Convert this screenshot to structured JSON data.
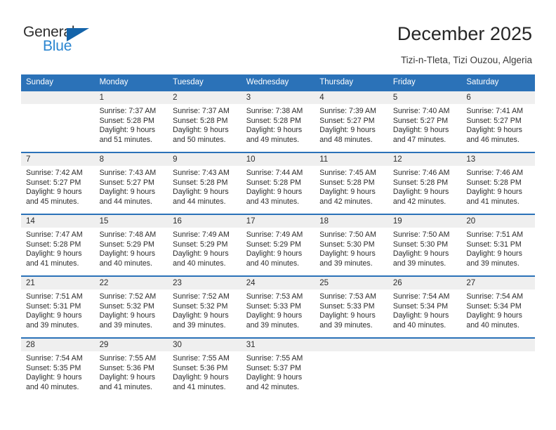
{
  "brand": {
    "name_top": "General",
    "name_bottom": "Blue",
    "triangle_color": "#1464aa",
    "blue_color": "#2a85d0"
  },
  "header": {
    "title": "December 2025",
    "location": "Tizi-n-Tleta, Tizi Ouzou, Algeria"
  },
  "theme": {
    "header_bg": "#2b72b8",
    "daynum_bg": "#efefef",
    "grid_line": "#2b72b8"
  },
  "weekdays": [
    "Sunday",
    "Monday",
    "Tuesday",
    "Wednesday",
    "Thursday",
    "Friday",
    "Saturday"
  ],
  "weeks": [
    [
      {
        "day": "",
        "lines": []
      },
      {
        "day": "1",
        "lines": [
          "Sunrise: 7:37 AM",
          "Sunset: 5:28 PM",
          "Daylight: 9 hours",
          "and 51 minutes."
        ]
      },
      {
        "day": "2",
        "lines": [
          "Sunrise: 7:37 AM",
          "Sunset: 5:28 PM",
          "Daylight: 9 hours",
          "and 50 minutes."
        ]
      },
      {
        "day": "3",
        "lines": [
          "Sunrise: 7:38 AM",
          "Sunset: 5:28 PM",
          "Daylight: 9 hours",
          "and 49 minutes."
        ]
      },
      {
        "day": "4",
        "lines": [
          "Sunrise: 7:39 AM",
          "Sunset: 5:27 PM",
          "Daylight: 9 hours",
          "and 48 minutes."
        ]
      },
      {
        "day": "5",
        "lines": [
          "Sunrise: 7:40 AM",
          "Sunset: 5:27 PM",
          "Daylight: 9 hours",
          "and 47 minutes."
        ]
      },
      {
        "day": "6",
        "lines": [
          "Sunrise: 7:41 AM",
          "Sunset: 5:27 PM",
          "Daylight: 9 hours",
          "and 46 minutes."
        ]
      }
    ],
    [
      {
        "day": "7",
        "lines": [
          "Sunrise: 7:42 AM",
          "Sunset: 5:27 PM",
          "Daylight: 9 hours",
          "and 45 minutes."
        ]
      },
      {
        "day": "8",
        "lines": [
          "Sunrise: 7:43 AM",
          "Sunset: 5:27 PM",
          "Daylight: 9 hours",
          "and 44 minutes."
        ]
      },
      {
        "day": "9",
        "lines": [
          "Sunrise: 7:43 AM",
          "Sunset: 5:28 PM",
          "Daylight: 9 hours",
          "and 44 minutes."
        ]
      },
      {
        "day": "10",
        "lines": [
          "Sunrise: 7:44 AM",
          "Sunset: 5:28 PM",
          "Daylight: 9 hours",
          "and 43 minutes."
        ]
      },
      {
        "day": "11",
        "lines": [
          "Sunrise: 7:45 AM",
          "Sunset: 5:28 PM",
          "Daylight: 9 hours",
          "and 42 minutes."
        ]
      },
      {
        "day": "12",
        "lines": [
          "Sunrise: 7:46 AM",
          "Sunset: 5:28 PM",
          "Daylight: 9 hours",
          "and 42 minutes."
        ]
      },
      {
        "day": "13",
        "lines": [
          "Sunrise: 7:46 AM",
          "Sunset: 5:28 PM",
          "Daylight: 9 hours",
          "and 41 minutes."
        ]
      }
    ],
    [
      {
        "day": "14",
        "lines": [
          "Sunrise: 7:47 AM",
          "Sunset: 5:28 PM",
          "Daylight: 9 hours",
          "and 41 minutes."
        ]
      },
      {
        "day": "15",
        "lines": [
          "Sunrise: 7:48 AM",
          "Sunset: 5:29 PM",
          "Daylight: 9 hours",
          "and 40 minutes."
        ]
      },
      {
        "day": "16",
        "lines": [
          "Sunrise: 7:49 AM",
          "Sunset: 5:29 PM",
          "Daylight: 9 hours",
          "and 40 minutes."
        ]
      },
      {
        "day": "17",
        "lines": [
          "Sunrise: 7:49 AM",
          "Sunset: 5:29 PM",
          "Daylight: 9 hours",
          "and 40 minutes."
        ]
      },
      {
        "day": "18",
        "lines": [
          "Sunrise: 7:50 AM",
          "Sunset: 5:30 PM",
          "Daylight: 9 hours",
          "and 39 minutes."
        ]
      },
      {
        "day": "19",
        "lines": [
          "Sunrise: 7:50 AM",
          "Sunset: 5:30 PM",
          "Daylight: 9 hours",
          "and 39 minutes."
        ]
      },
      {
        "day": "20",
        "lines": [
          "Sunrise: 7:51 AM",
          "Sunset: 5:31 PM",
          "Daylight: 9 hours",
          "and 39 minutes."
        ]
      }
    ],
    [
      {
        "day": "21",
        "lines": [
          "Sunrise: 7:51 AM",
          "Sunset: 5:31 PM",
          "Daylight: 9 hours",
          "and 39 minutes."
        ]
      },
      {
        "day": "22",
        "lines": [
          "Sunrise: 7:52 AM",
          "Sunset: 5:32 PM",
          "Daylight: 9 hours",
          "and 39 minutes."
        ]
      },
      {
        "day": "23",
        "lines": [
          "Sunrise: 7:52 AM",
          "Sunset: 5:32 PM",
          "Daylight: 9 hours",
          "and 39 minutes."
        ]
      },
      {
        "day": "24",
        "lines": [
          "Sunrise: 7:53 AM",
          "Sunset: 5:33 PM",
          "Daylight: 9 hours",
          "and 39 minutes."
        ]
      },
      {
        "day": "25",
        "lines": [
          "Sunrise: 7:53 AM",
          "Sunset: 5:33 PM",
          "Daylight: 9 hours",
          "and 39 minutes."
        ]
      },
      {
        "day": "26",
        "lines": [
          "Sunrise: 7:54 AM",
          "Sunset: 5:34 PM",
          "Daylight: 9 hours",
          "and 40 minutes."
        ]
      },
      {
        "day": "27",
        "lines": [
          "Sunrise: 7:54 AM",
          "Sunset: 5:34 PM",
          "Daylight: 9 hours",
          "and 40 minutes."
        ]
      }
    ],
    [
      {
        "day": "28",
        "lines": [
          "Sunrise: 7:54 AM",
          "Sunset: 5:35 PM",
          "Daylight: 9 hours",
          "and 40 minutes."
        ]
      },
      {
        "day": "29",
        "lines": [
          "Sunrise: 7:55 AM",
          "Sunset: 5:36 PM",
          "Daylight: 9 hours",
          "and 41 minutes."
        ]
      },
      {
        "day": "30",
        "lines": [
          "Sunrise: 7:55 AM",
          "Sunset: 5:36 PM",
          "Daylight: 9 hours",
          "and 41 minutes."
        ]
      },
      {
        "day": "31",
        "lines": [
          "Sunrise: 7:55 AM",
          "Sunset: 5:37 PM",
          "Daylight: 9 hours",
          "and 42 minutes."
        ]
      },
      {
        "day": "",
        "lines": []
      },
      {
        "day": "",
        "lines": []
      },
      {
        "day": "",
        "lines": []
      }
    ]
  ]
}
